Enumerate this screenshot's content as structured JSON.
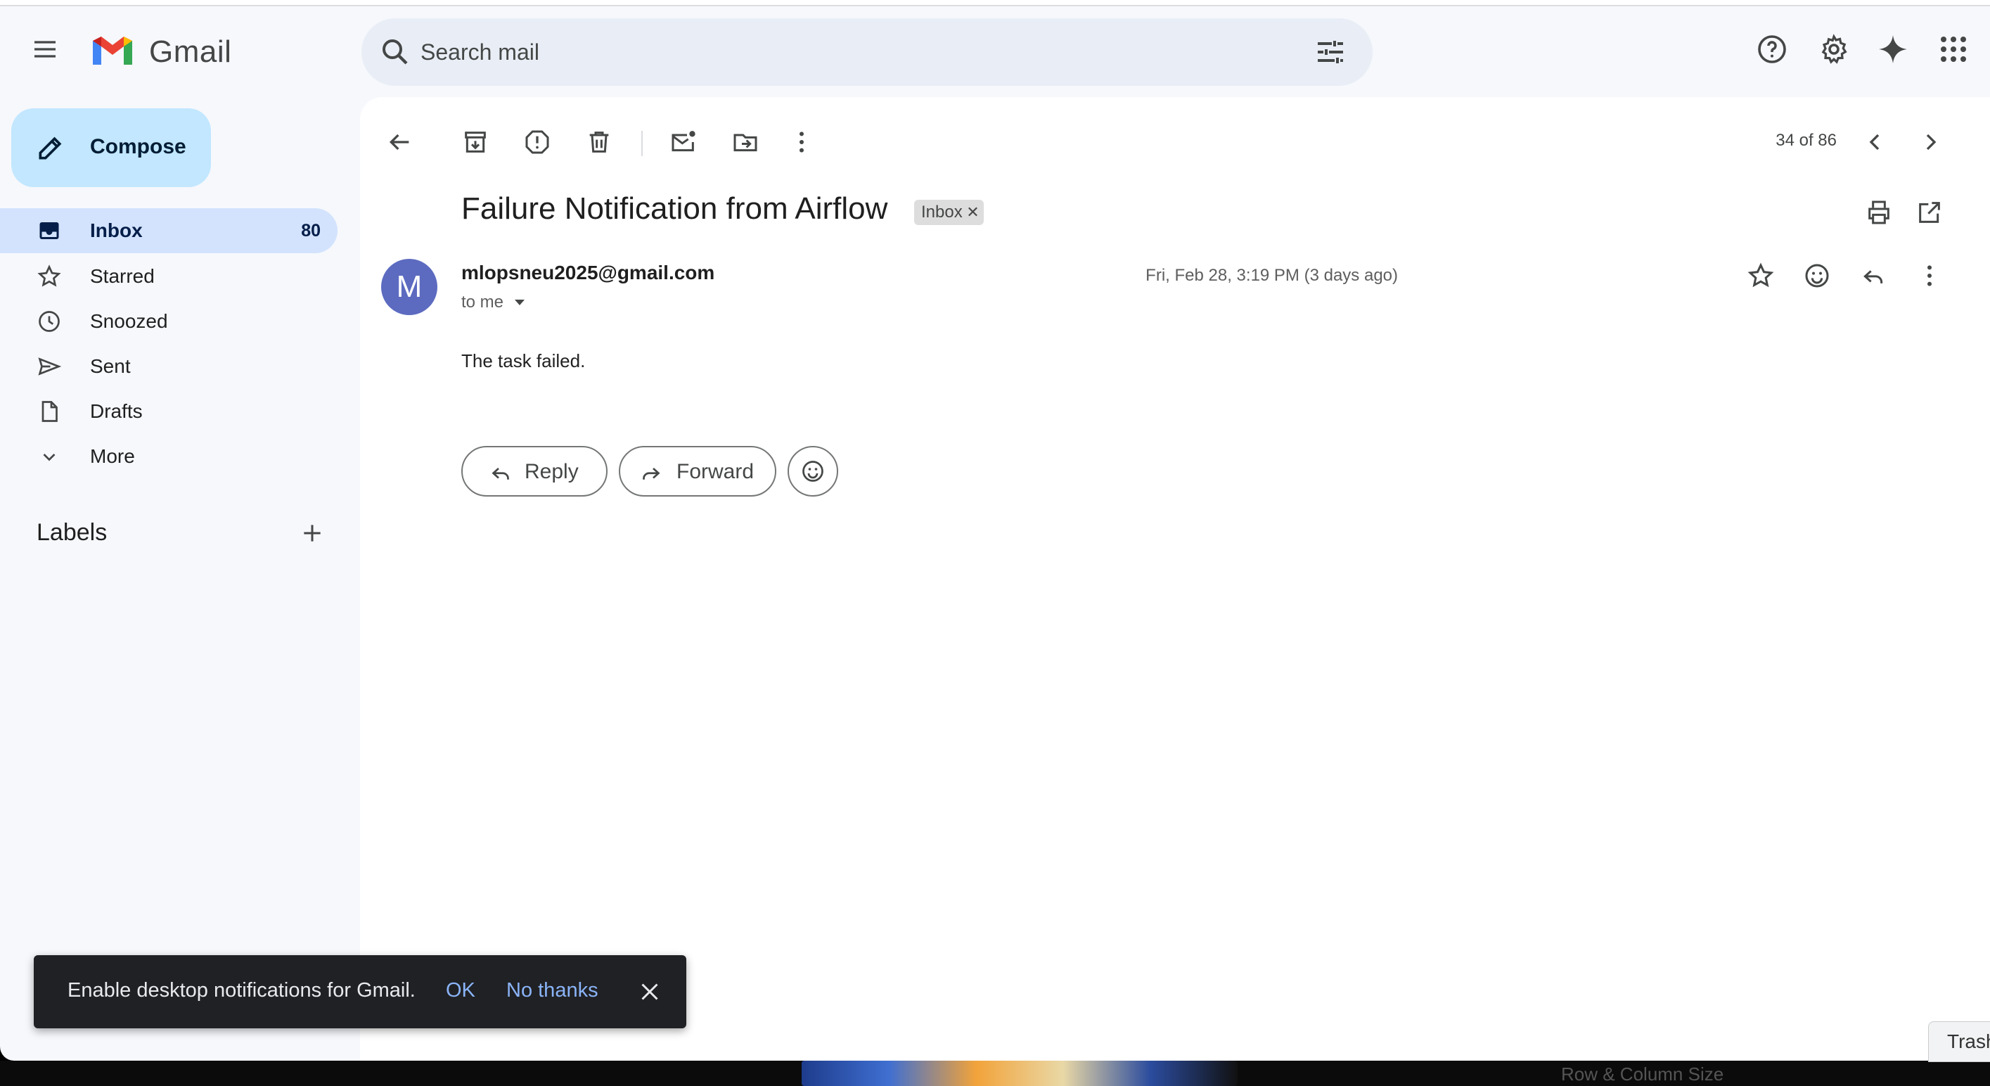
{
  "app": {
    "brand": "Gmail"
  },
  "search": {
    "placeholder": "Search mail"
  },
  "sidebar": {
    "compose_label": "Compose",
    "items": [
      {
        "label": "Inbox",
        "count": "80",
        "icon": "inbox-icon",
        "active": true
      },
      {
        "label": "Starred",
        "icon": "star-icon"
      },
      {
        "label": "Snoozed",
        "icon": "clock-icon"
      },
      {
        "label": "Sent",
        "icon": "send-icon"
      },
      {
        "label": "Drafts",
        "icon": "draft-icon"
      },
      {
        "label": "More",
        "icon": "chevron-down-icon"
      }
    ],
    "labels_title": "Labels"
  },
  "toolbar": {
    "pager": "34 of 86"
  },
  "message": {
    "subject": "Failure Notification from Airflow",
    "label_chip": "Inbox",
    "avatar_letter": "M",
    "sender": "mlopsneu2025@gmail.com",
    "to": "to me",
    "date": "Fri, Feb 28, 3:19 PM (3 days ago)",
    "body": "The task failed.",
    "reply_label": "Reply",
    "forward_label": "Forward"
  },
  "snackbar": {
    "message": "Enable desktop notifications for Gmail.",
    "ok": "OK",
    "no_thanks": "No thanks"
  },
  "desktop": {
    "trash_label": "Trash",
    "strip_text": "Row & Column Size"
  },
  "colors": {
    "accent": "#c2e7ff",
    "active_nav": "#d3e3fd",
    "avatar": "#5c6bc0",
    "snackbar_link": "#8ab4f8"
  }
}
